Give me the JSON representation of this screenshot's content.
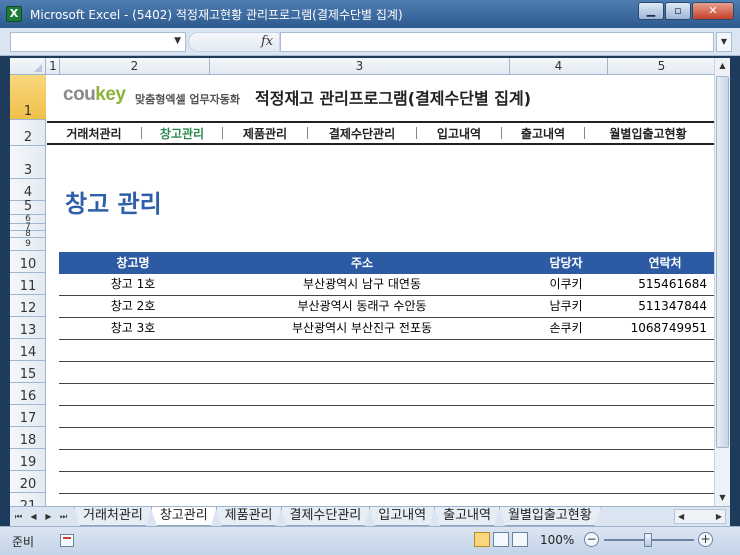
{
  "window": {
    "title": "Microsoft Excel - (5402) 적정재고현황 관리프로그램(결제수단별 집계)",
    "app_icon": "excel-icon",
    "minimize_icon": "minimize-icon",
    "maximize_icon": "maximize-icon",
    "close_icon": "close-icon"
  },
  "formula_bar": {
    "name_box": "",
    "fx_label": "fx",
    "formula": ""
  },
  "columns": [
    "1",
    "2",
    "3",
    "4",
    "5"
  ],
  "rows": [
    "1",
    "2",
    "3",
    "4",
    "5",
    "6",
    "7",
    "8",
    "9",
    "10",
    "11",
    "12",
    "13",
    "14",
    "15",
    "16",
    "17",
    "18",
    "19",
    "20",
    "21"
  ],
  "header": {
    "logo_cou": "cou",
    "logo_key": "key",
    "logo_sub": "맞춤형엑셀 업무자동화",
    "program_title": "적정재고 관리프로그램(결제수단별 집계)"
  },
  "menu": {
    "items": [
      "거래처관리",
      "창고관리",
      "제품관리",
      "결제수단관리",
      "입고내역",
      "출고내역",
      "월별입출고현황"
    ],
    "active": "창고관리"
  },
  "page_heading": "창고 관리",
  "table": {
    "headers": [
      "창고명",
      "주소",
      "담당자",
      "연락처"
    ],
    "rows": [
      [
        "창고 1호",
        "부산광역시 남구 대연동",
        "이쿠키",
        "515461684"
      ],
      [
        "창고 2호",
        "부산광역시 동래구 수안동",
        "남쿠키",
        "511347844"
      ],
      [
        "창고 3호",
        "부산광역시 부산진구 전포동",
        "손쿠키",
        "1068749951"
      ]
    ]
  },
  "sheet_tabs": {
    "items": [
      "거래처관리",
      "창고관리",
      "제품관리",
      "결제수단관리",
      "입고내역",
      "출고내역",
      "월별입출고현황"
    ],
    "active": "창고관리"
  },
  "status_bar": {
    "ready": "준비",
    "zoom": "100%",
    "zoom_minus": "−",
    "zoom_plus": "+"
  }
}
